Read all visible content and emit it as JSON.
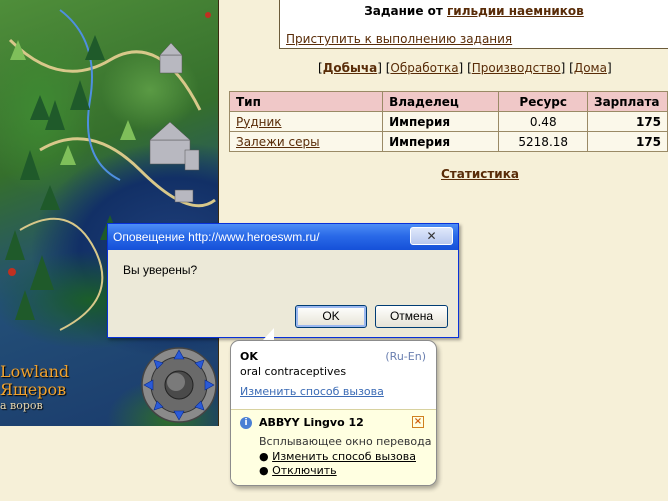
{
  "map": {
    "region_title_line1": "Lowland",
    "region_title_line2": "Ящеров",
    "region_subtitle": "а воров"
  },
  "task": {
    "title_prefix": "Задание от ",
    "title_link": "гильдии наемников",
    "action_link": "Приступить к выполнению задания"
  },
  "tabs": [
    {
      "label": "Добыча",
      "active": true
    },
    {
      "label": "Обработка",
      "active": false
    },
    {
      "label": "Производство",
      "active": false
    },
    {
      "label": "Дома",
      "active": false
    }
  ],
  "table": {
    "headers": [
      "Тип",
      "Владелец",
      "Ресурс",
      "Зарплата"
    ],
    "rows": [
      {
        "type": "Рудник",
        "owner": "Империя",
        "resource": "0.48",
        "pay": "175"
      },
      {
        "type": "Залежи серы",
        "owner": "Империя",
        "resource": "5218.18",
        "pay": "175"
      }
    ]
  },
  "stats_link": "Статистика",
  "dialog": {
    "title": "Оповещение http://www.heroeswm.ru/",
    "close_glyph": "✕",
    "message": "Вы уверены?",
    "ok_label": "OK",
    "cancel_label": "Отмена"
  },
  "lingvo": {
    "word": "OK",
    "lang": "(Ru-En)",
    "translation": "oral contraceptives",
    "change_link": "Изменить способ вызова",
    "app_name": "ABBYY Lingvo 12",
    "description": "Всплывающее окно перевода",
    "options": [
      "Изменить способ вызова",
      "Отключить"
    ]
  },
  "colors": {
    "page_bg": "#f6f0d8",
    "link": "#592c08",
    "table_header": "#f0c8c8",
    "titlebar": "#2a6ae8",
    "region_text": "#f0a22e"
  }
}
